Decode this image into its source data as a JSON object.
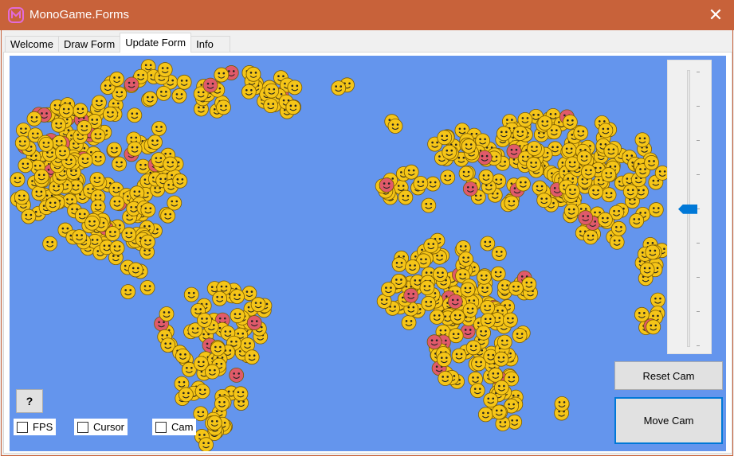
{
  "window": {
    "title": "MonoGame.Forms",
    "close_glyph": "✕",
    "app_icon": "monogame-logo-icon",
    "titlebar_color": "#c8623a"
  },
  "tabs": [
    {
      "label": "Welcome",
      "active": false
    },
    {
      "label": "Draw Form",
      "active": false
    },
    {
      "label": "Update Form",
      "active": true
    },
    {
      "label": "Info",
      "active": false
    }
  ],
  "viewport": {
    "background_color": "#6495ed",
    "content": "world map made of smiley emoticons",
    "smiley_color": "#f5c518",
    "angry_smiley_color": "#e05a6a"
  },
  "controls": {
    "help_label": "?",
    "checkboxes": [
      {
        "label": "FPS",
        "checked": false
      },
      {
        "label": "Cursor",
        "checked": false
      },
      {
        "label": "Cam",
        "checked": false
      }
    ],
    "reset_cam_label": "Reset Cam",
    "move_cam_label": "Move Cam",
    "zoom_slider_ticks": 9,
    "zoom_slider_level": 0.52
  }
}
